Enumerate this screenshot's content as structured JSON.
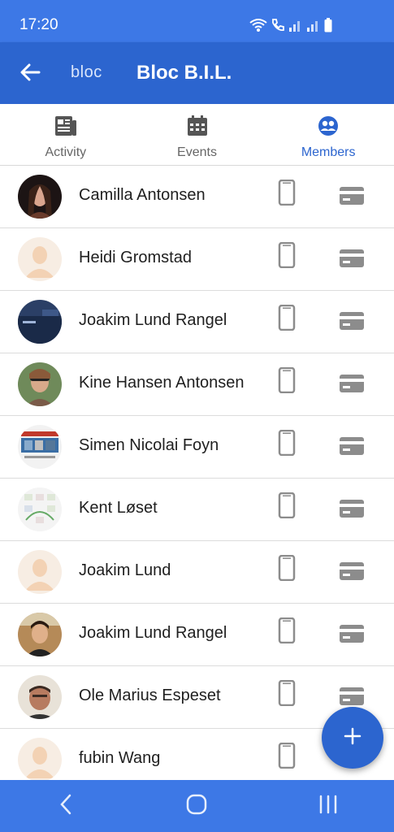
{
  "status_bar": {
    "time": "17:20",
    "icons": [
      "wifi-icon",
      "call-icon",
      "signal-icon",
      "signal-icon",
      "battery-icon"
    ]
  },
  "app_bar": {
    "back_icon": "arrow-left-icon",
    "logo_text": "bloc",
    "title": "Bloc B.I.L."
  },
  "tabs": [
    {
      "label": "Activity",
      "icon": "newspaper-icon",
      "active": false
    },
    {
      "label": "Events",
      "icon": "calendar-icon",
      "active": false
    },
    {
      "label": "Members",
      "icon": "people-icon",
      "active": true
    }
  ],
  "members": [
    {
      "name": "Camilla Antonsen"
    },
    {
      "name": "Heidi Gromstad"
    },
    {
      "name": "Joakim Lund Rangel"
    },
    {
      "name": "Kine Hansen Antonsen"
    },
    {
      "name": "Simen Nicolai Foyn"
    },
    {
      "name": "Kent Løset"
    },
    {
      "name": "Joakim Lund"
    },
    {
      "name": "Joakim Lund Rangel"
    },
    {
      "name": "Ole Marius Espeset"
    },
    {
      "name": "fubin Wang"
    }
  ],
  "fab": {
    "icon": "plus-icon"
  },
  "nav_bar": {
    "icons": [
      "back-nav-icon",
      "home-nav-icon",
      "recents-nav-icon"
    ]
  },
  "colors": {
    "primary": "#2c65cf",
    "status": "#3d78e6",
    "icon_gray": "#8c8c8c"
  }
}
